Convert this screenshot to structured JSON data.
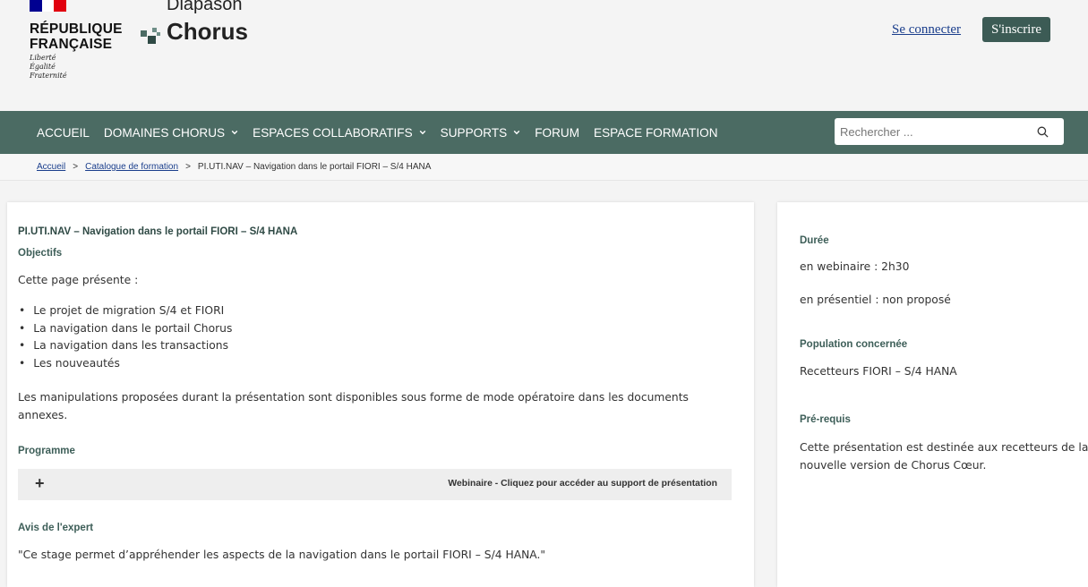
{
  "header": {
    "flag_colors": [
      "#000091",
      "#ffffff",
      "#e1000f"
    ],
    "republic_name": "RÉPUBLIQUE\nFRANÇAISE",
    "motto": "Liberté\nÉgalité\nFraternité",
    "brand_top": "Diapason",
    "brand_main": "Chorus",
    "login_label": "Se connecter",
    "signup_label": "S'inscrire"
  },
  "nav": {
    "items": [
      {
        "label": "ACCUEIL",
        "has_dropdown": false
      },
      {
        "label": "DOMAINES CHORUS",
        "has_dropdown": true
      },
      {
        "label": "ESPACES COLLABORATIFS",
        "has_dropdown": true
      },
      {
        "label": "SUPPORTS",
        "has_dropdown": true
      },
      {
        "label": "FORUM",
        "has_dropdown": false
      },
      {
        "label": "ESPACE FORMATION",
        "has_dropdown": false
      }
    ],
    "search_placeholder": "Rechercher ...",
    "search_value": ""
  },
  "breadcrumb": {
    "items": [
      {
        "label": "Accueil",
        "link": true
      },
      {
        "label": "Catalogue de formation",
        "link": true
      },
      {
        "label": "PI.UTI.NAV – Navigation dans le portail FIORI – S/4 HANA",
        "link": false
      }
    ],
    "separator": ">"
  },
  "main": {
    "title": "PI.UTI.NAV – Navigation dans le portail FIORI – S/4 HANA",
    "objectives_heading": "Objectifs",
    "intro": "Cette page présente :",
    "bullets": [
      "Le projet de migration S/4 et FIORI",
      "La navigation dans le portail Chorus",
      "La navigation dans les transactions",
      "Les nouveautés"
    ],
    "paragraph": "Les manipulations proposées durant la présentation sont disponibles sous forme de mode opératoire dans les documents annexes.",
    "programme_heading": "Programme",
    "accordion_label": "Webinaire - Cliquez pour accéder au support de présentation",
    "expert_heading": "Avis de l'expert",
    "expert_quote": "\"Ce stage permet d’appréhender les aspects de la navigation dans le portail FIORI – S/4 HANA.\""
  },
  "sidebar": {
    "duration_heading": "Durée",
    "webinar_duration": "en webinaire : 2h30",
    "onsite_duration": "en présentiel : non proposé",
    "population_heading": "Population concernée",
    "population": "Recetteurs FIORI – S/4 HANA",
    "prereq_heading": "Pré-requis",
    "prereq": "Cette présentation est destinée aux recetteurs de la nouvelle version de Chorus Cœur."
  },
  "colors": {
    "nav_bg": "#4b6b63",
    "signup_bg": "#3c5b55",
    "link": "#1a3e8c",
    "heading": "#3d5e58"
  }
}
